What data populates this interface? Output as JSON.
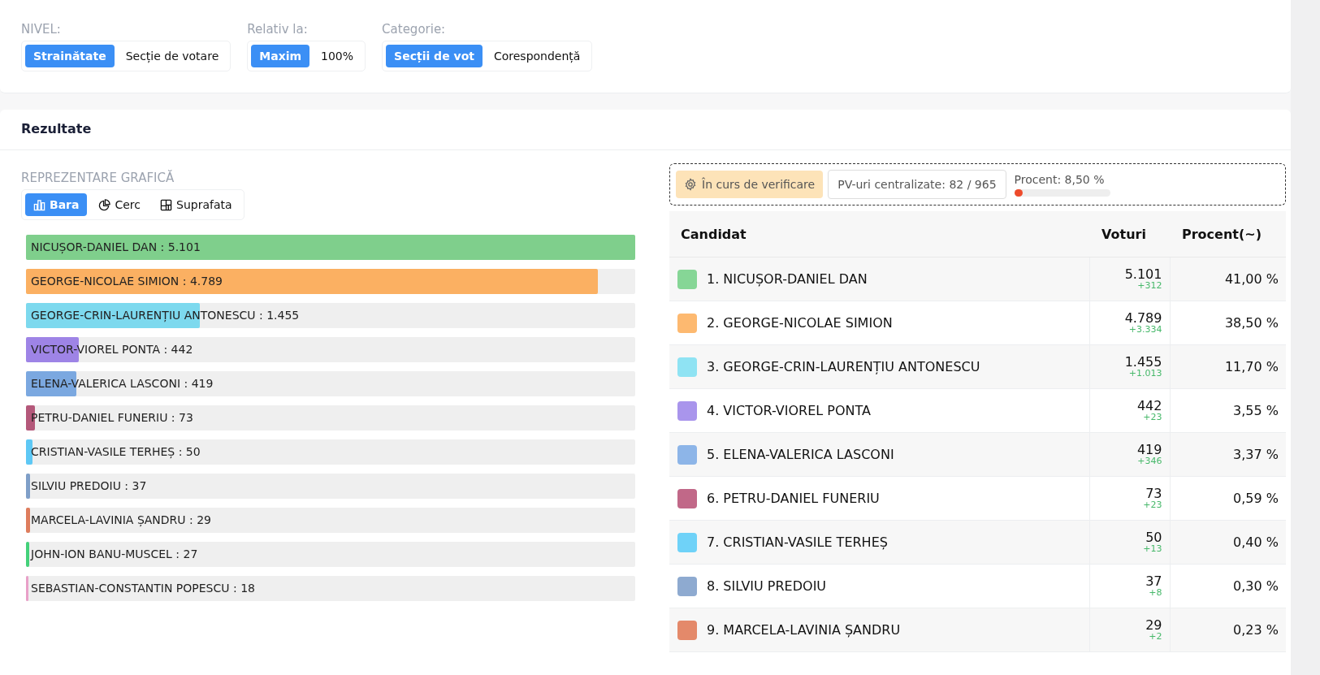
{
  "filters": [
    {
      "label": "NIVEL:",
      "options": [
        {
          "label": "Strainătate",
          "selected": true
        },
        {
          "label": "Secție de votare",
          "selected": false
        }
      ]
    },
    {
      "label": "Relativ la:",
      "options": [
        {
          "label": "Maxim",
          "selected": true
        },
        {
          "label": "100%",
          "selected": false
        }
      ]
    },
    {
      "label": "Categorie:",
      "options": [
        {
          "label": "Secții de vot",
          "selected": true
        },
        {
          "label": "Corespondență",
          "selected": false
        }
      ]
    }
  ],
  "results": {
    "title": "Rezultate",
    "chart_section": {
      "label": "REPREZENTARE GRAFICĂ",
      "views": [
        {
          "label": "Bara",
          "kind": "bar",
          "selected": true
        },
        {
          "label": "Cerc",
          "kind": "pie",
          "selected": false
        },
        {
          "label": "Suprafata",
          "kind": "area",
          "selected": false
        }
      ],
      "bars": [
        {
          "label": "NICUȘOR-DANIEL DAN : 5.101",
          "level": 1,
          "color": "#7fcf8c"
        },
        {
          "label": "GEORGE-NICOLAE SIMION : 4.789",
          "level": 0.939,
          "color": "#fbb062"
        },
        {
          "label": "GEORGE-CRIN-LAURENȚIU ANTONESCU : 1.455",
          "level": 0.285,
          "color": "#7dd9ee"
        },
        {
          "label": "VICTOR-VIOREL PONTA : 442",
          "level": 0.087,
          "color": "#9e84e6"
        },
        {
          "label": "ELENA-VALERICA LASCONI : 419",
          "level": 0.082,
          "color": "#7ba8e0"
        },
        {
          "label": "PETRU-DANIEL FUNERIU : 73",
          "level": 0.014,
          "color": "#b4587a"
        },
        {
          "label": "CRISTIAN-VASILE TERHEȘ : 50",
          "level": 0.01,
          "color": "#5ec8f5"
        },
        {
          "label": "SILVIU PREDOIU : 37",
          "level": 0.007,
          "color": "#7f9fc8"
        },
        {
          "label": "MARCELA-LAVINIA ȘANDRU : 29",
          "level": 0.006,
          "color": "#de7d5d"
        },
        {
          "label": "JOHN-ION BANU-MUSCEL : 27",
          "level": 0.005,
          "color": "#44d17a"
        },
        {
          "label": "SEBASTIAN-CONSTANTIN POPESCU : 18",
          "level": 0.004,
          "color": "#e8a0c8"
        }
      ]
    },
    "status": {
      "badge": "În curs de verificare",
      "counter": "PV-uri centralizate: 82 / 965",
      "progress_label": "Procent: 8,50 %",
      "level": 0.085
    },
    "table": {
      "columns": [
        "Candidat",
        "Voturi",
        "Procent(~)"
      ],
      "rows": [
        {
          "candidate": "1. NICUȘOR-DANIEL DAN",
          "votes": "5.101",
          "change": "+312",
          "percent": "41,00 %",
          "color": "#86d696"
        },
        {
          "candidate": "2. GEORGE-NICOLAE SIMION",
          "votes": "4.789",
          "change": "+3.334",
          "percent": "38,50 %",
          "color": "#fdb970"
        },
        {
          "candidate": "3. GEORGE-CRIN-LAURENȚIU ANTONESCU",
          "votes": "1.455",
          "change": "+1.013",
          "percent": "11,70 %",
          "color": "#8fe3f3"
        },
        {
          "candidate": "4. VICTOR-VIOREL PONTA",
          "votes": "442",
          "change": "+23",
          "percent": "3,55 %",
          "color": "#a995ec"
        },
        {
          "candidate": "5. ELENA-VALERICA LASCONI",
          "votes": "419",
          "change": "+346",
          "percent": "3,37 %",
          "color": "#8db5e8"
        },
        {
          "candidate": "6. PETRU-DANIEL FUNERIU",
          "votes": "73",
          "change": "+23",
          "percent": "0,59 %",
          "color": "#c16888"
        },
        {
          "candidate": "7. CRISTIAN-VASILE TERHEȘ",
          "votes": "50",
          "change": "+13",
          "percent": "0,40 %",
          "color": "#6fd2f8"
        },
        {
          "candidate": "8. SILVIU PREDOIU",
          "votes": "37",
          "change": "+8",
          "percent": "0,30 %",
          "color": "#8eaad0"
        },
        {
          "candidate": "9. MARCELA-LAVINIA ȘANDRU",
          "votes": "29",
          "change": "+2",
          "percent": "0,23 %",
          "color": "#e4896a"
        }
      ]
    }
  }
}
